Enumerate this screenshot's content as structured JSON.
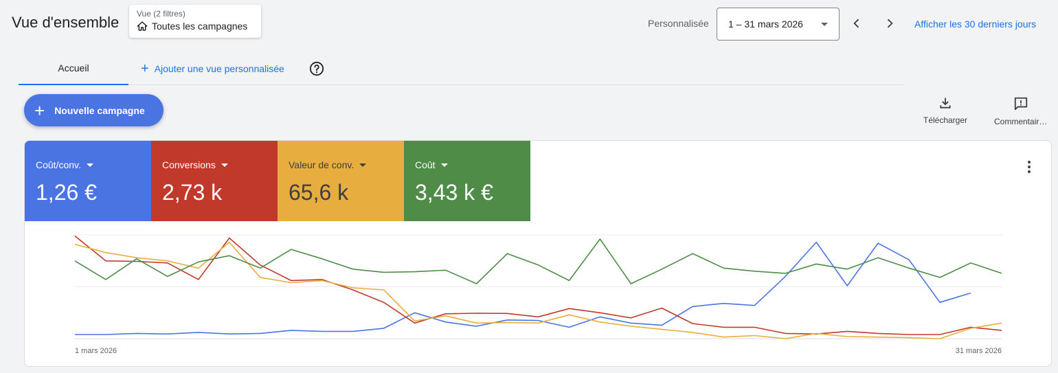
{
  "header": {
    "title": "Vue d'ensemble",
    "view_chip": {
      "label": "Vue (2 filtres)",
      "value": "Toutes les campagnes"
    },
    "date_range_label": "Personnalisée",
    "date_range_value": "1 – 31 mars 2026",
    "last30_link": "Afficher les 30 derniers jours"
  },
  "tabs": {
    "home": "Accueil",
    "add_view": "Ajouter une vue personnalisée"
  },
  "new_campaign_button": "Nouvelle campagne",
  "toolbar": {
    "download": "Télécharger",
    "comments": "Commentaires"
  },
  "metrics": [
    {
      "label": "Coût/conv.",
      "value": "1,26 €",
      "color": "#4b74e3"
    },
    {
      "label": "Conversions",
      "value": "2,73 k",
      "color": "#c0392b"
    },
    {
      "label": "Valeur de conv.",
      "value": "65,6 k",
      "color": "#e8ad3f"
    },
    {
      "label": "Coût",
      "value": "3,43 k €",
      "color": "#4e8c47"
    }
  ],
  "chart_data": {
    "type": "line",
    "x": [
      1,
      2,
      3,
      4,
      5,
      6,
      7,
      8,
      9,
      10,
      11,
      12,
      13,
      14,
      15,
      16,
      17,
      18,
      19,
      20,
      21,
      22,
      23,
      24,
      25,
      26,
      27,
      28,
      29,
      30,
      31
    ],
    "x_tick_labels": [
      "1 mars 2026",
      "31 mars 2026"
    ],
    "ylim": [
      0,
      100
    ],
    "grid": true,
    "series": [
      {
        "color": "#4b74e3",
        "values": [
          4,
          4,
          5,
          4.5,
          6,
          4.5,
          5,
          8,
          7,
          7,
          10,
          25,
          16,
          12,
          18,
          17.5,
          11,
          21,
          15,
          13,
          31,
          34,
          32,
          60,
          93,
          51,
          92,
          76,
          35,
          44
        ]
      },
      {
        "color": "#c0392b",
        "values": [
          99,
          75,
          74.5,
          73,
          57,
          97,
          71,
          56,
          57,
          47,
          35,
          15,
          24,
          24.5,
          24.3,
          21,
          29,
          25,
          20,
          29.5,
          14.5,
          11,
          11,
          5,
          4.5,
          7,
          5,
          4,
          4,
          11,
          8
        ]
      },
      {
        "color": "#e8ad3f",
        "values": [
          91,
          83,
          78,
          75,
          68,
          93,
          59,
          54,
          56,
          49,
          47,
          17,
          22,
          15,
          15.5,
          15,
          23,
          16,
          12,
          9,
          6,
          1.5,
          3,
          0,
          5,
          2,
          1.5,
          1,
          0,
          10,
          15
        ]
      },
      {
        "color": "#4e8c47",
        "values": [
          75,
          57,
          77,
          60,
          74,
          80,
          68,
          86,
          77,
          67,
          64,
          64.5,
          66,
          53,
          82,
          71,
          56,
          96,
          53,
          67,
          82,
          68,
          65,
          63,
          72,
          67,
          78,
          68,
          59,
          73,
          63
        ]
      }
    ]
  }
}
